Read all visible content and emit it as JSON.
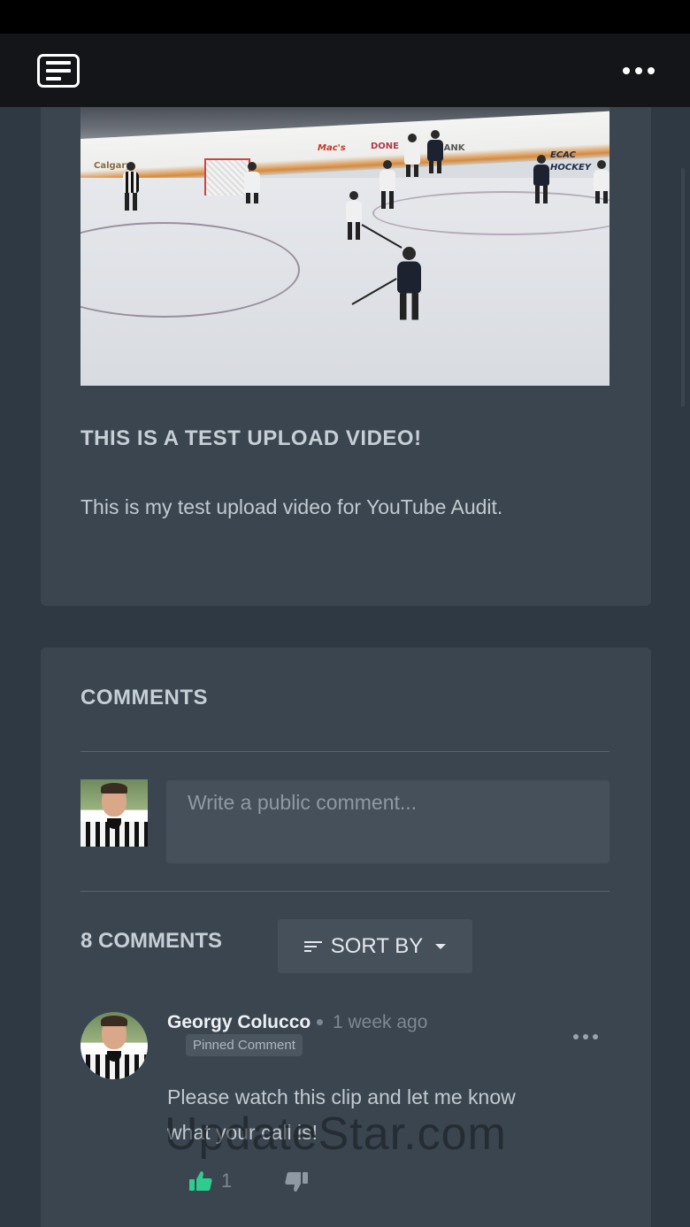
{
  "app_bar": {
    "logo_icon": "video-library-icon",
    "more_icon": "more-horizontal-icon"
  },
  "video": {
    "thumbnail_icon": "hockey-rink-thumbnail",
    "ads": [
      "Calgary",
      "Mac's",
      "DONE",
      "BANK",
      "ECAC HOCKEY"
    ],
    "title": "THIS IS A TEST UPLOAD VIDEO!",
    "description": "This is my test upload video for YouTube Audit."
  },
  "comments": {
    "heading": "COMMENTS",
    "input_placeholder": "Write a public comment...",
    "count_label": "8 COMMENTS",
    "sort_label": "SORT BY",
    "items": [
      {
        "author": "Georgy Colucco",
        "time": "1 week ago",
        "badge": "Pinned Comment",
        "text": "Please watch this clip and let me know what your call is!",
        "likes": "1"
      }
    ]
  },
  "watermark": "UpdateStar.com",
  "colors": {
    "accent_like": "#2ecc8f",
    "background": "#2f3943",
    "card": "#3a4550"
  }
}
